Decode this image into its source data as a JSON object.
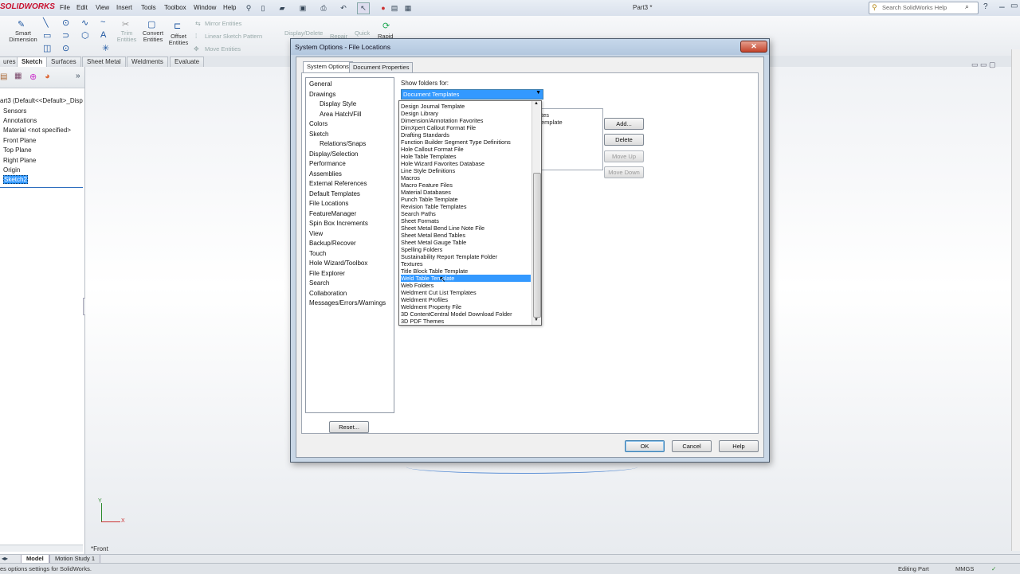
{
  "app": {
    "logo": "SOLIDWORKS",
    "doc_title": "Part3 *",
    "menu": [
      "File",
      "Edit",
      "View",
      "Insert",
      "Tools",
      "Toolbox",
      "Window",
      "Help"
    ],
    "help_search_placeholder": "Search SolidWorks Help"
  },
  "command_manager": {
    "smart_dimension": "Smart\nDimension",
    "trim": "Trim\nEntities",
    "convert": "Convert\nEntities",
    "offset": "Offset\nEntities",
    "mirror": "Mirror Entities",
    "linear_pattern": "Linear Sketch Pattern",
    "move": "Move Entities",
    "display_delete": "Display/Delete",
    "repair": "Repair",
    "quick": "Quick",
    "rapid": "Rapid"
  },
  "tabs": [
    "ures",
    "Sketch",
    "Surfaces",
    "Sheet Metal",
    "Weldments",
    "Evaluate"
  ],
  "feature_tree": {
    "root": "art3  (Default<<Default>_Disp",
    "items": [
      "Sensors",
      "Annotations",
      "Material <not specified>",
      "Front Plane",
      "Top Plane",
      "Right Plane",
      "Origin",
      "Sketch2"
    ],
    "selected_index": 7
  },
  "graphics": {
    "view_label": "*Front"
  },
  "bottom_tabs": [
    "Model",
    "Motion Study 1"
  ],
  "status": {
    "left": "es options settings for SolidWorks.",
    "editing": "Editing Part",
    "units": "MMGS"
  },
  "dialog": {
    "title": "System Options - File Locations",
    "close": "✕",
    "tabs": [
      "System Options",
      "Document Properties"
    ],
    "categories": [
      {
        "label": "General",
        "indent": false
      },
      {
        "label": "Drawings",
        "indent": false
      },
      {
        "label": "Display Style",
        "indent": true
      },
      {
        "label": "Area Hatch/Fill",
        "indent": true
      },
      {
        "label": "Colors",
        "indent": false
      },
      {
        "label": "Sketch",
        "indent": false
      },
      {
        "label": "Relations/Snaps",
        "indent": true
      },
      {
        "label": "Display/Selection",
        "indent": false
      },
      {
        "label": "Performance",
        "indent": false
      },
      {
        "label": "Assemblies",
        "indent": false
      },
      {
        "label": "External References",
        "indent": false
      },
      {
        "label": "Default Templates",
        "indent": false
      },
      {
        "label": "File Locations",
        "indent": false
      },
      {
        "label": "FeatureManager",
        "indent": false
      },
      {
        "label": "Spin Box Increments",
        "indent": false
      },
      {
        "label": "View",
        "indent": false
      },
      {
        "label": "Backup/Recover",
        "indent": false
      },
      {
        "label": "Touch",
        "indent": false
      },
      {
        "label": "Hole Wizard/Toolbox",
        "indent": false
      },
      {
        "label": "File Explorer",
        "indent": false
      },
      {
        "label": "Search",
        "indent": false
      },
      {
        "label": "Collaboration",
        "indent": false
      },
      {
        "label": "Messages/Errors/Warnings",
        "indent": false
      }
    ],
    "show_folders_label": "Show folders for:",
    "show_folders_value": "Document Templates",
    "bg_partial_1": "tes",
    "bg_partial_2": "emplate",
    "buttons": {
      "add": "Add...",
      "delete": "Delete",
      "move_up": "Move Up",
      "move_down": "Move Down",
      "reset": "Reset...",
      "ok": "OK",
      "cancel": "Cancel",
      "help": "Help"
    },
    "dropdown_options": [
      "Design Journal Template",
      "Design Library",
      "Dimension/Annotation Favorites",
      "DimXpert Callout Format File",
      "Drafting Standards",
      "Function Builder Segment Type Definitions",
      "Hole Callout Format File",
      "Hole Table Templates",
      "Hole Wizard Favorites Database",
      "Line Style Definitions",
      "Macros",
      "Macro Feature Files",
      "Material Databases",
      "Punch Table Template",
      "Revision Table Templates",
      "Search Paths",
      "Sheet Formats",
      "Sheet Metal Bend Line Note File",
      "Sheet Metal Bend Tables",
      "Sheet Metal Gauge Table",
      "Spelling Folders",
      "Sustainability Report Template Folder",
      "Textures",
      "Title Block Table Template",
      "Weld Table Template",
      "Web Folders",
      "Weldment Cut List Templates",
      "Weldment Profiles",
      "Weldment Property File",
      "3D ContentCentral Model Download Folder",
      "3D PDF Themes"
    ],
    "highlighted_option_index": 24
  }
}
